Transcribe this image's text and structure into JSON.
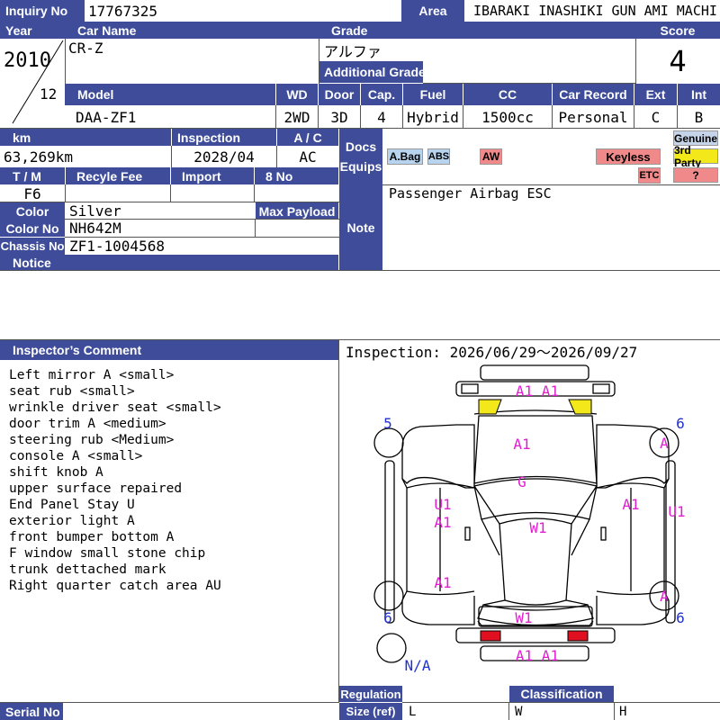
{
  "header": {
    "inquiry_label": "Inquiry No",
    "inquiry_value": "17767325",
    "area_label": "Area",
    "area_value": "IBARAKI INASHIKI GUN AMI MACHI",
    "year_label": "Year",
    "year_value": "2010",
    "month_value": "12",
    "car_name_label": "Car Name",
    "car_name_value": "CR-Z",
    "grade_label": "Grade",
    "grade_value": "アルファ",
    "additional_grade_label": "Additional Grade",
    "score_label": "Score",
    "score_value": "4"
  },
  "spec": {
    "model_label": "Model",
    "model_value": "DAA-ZF1",
    "wd_label": "WD",
    "wd_value": "2WD",
    "door_label": "Door",
    "door_value": "3D",
    "cap_label": "Cap.",
    "cap_value": "4",
    "fuel_label": "Fuel",
    "fuel_value": "Hybrid",
    "cc_label": "CC",
    "cc_value": "1500cc",
    "record_label": "Car Record",
    "record_value": "Personal",
    "ext_label": "Ext",
    "ext_value": "C",
    "int_label": "Int",
    "int_value": "B"
  },
  "details": {
    "km_label": "km",
    "km_value": "63,269km",
    "inspection_label": "Inspection",
    "inspection_value": "2028/04",
    "ac_label": "A / C",
    "ac_value": "AC",
    "tm_label": "T / M",
    "tm_value": "F6",
    "recycle_label": "Recyle Fee",
    "import_label": "Import",
    "no8_label": "8 No",
    "color_label": "Color",
    "color_value": "Silver",
    "payload_label": "Max Payload",
    "color_no_label": "Color No",
    "color_no_value": "NH642M",
    "chassis_label": "Chassis No",
    "chassis_value": "ZF1-1004568",
    "notice_label": "Notice"
  },
  "docs": {
    "docs_label": "Docs",
    "equips_label": "Equips",
    "badges": {
      "abag": "A.Bag",
      "abs": "ABS",
      "aw": "AW",
      "keyless": "Keyless",
      "genuine": "Genuine",
      "third_party": "3rd Party",
      "etc": "ETC",
      "unknown": "?"
    },
    "colors": {
      "blue": "#b7d3ee",
      "red": "#f08a8a",
      "yellow": "#f2e81a",
      "gray_blue": "#c5d4e8"
    }
  },
  "note": {
    "label": "Note",
    "value": "Passenger Airbag ESC"
  },
  "inspector": {
    "label": "Inspector’s Comment",
    "period": "Inspection: 2026/06/29～2026/09/27",
    "comments": [
      "Left mirror A <small>",
      "seat rub <small>",
      "wrinkle driver seat <small>",
      "door trim A <medium>",
      "steering rub <Medium>",
      "console A <small>",
      "shift knob A",
      "upper surface repaired",
      "End Panel Stay U",
      "exterior light A",
      "front bumper bottom A",
      "F window small stone chip",
      "trunk dettached mark",
      "Right quarter catch area AU"
    ]
  },
  "diagram": {
    "front_bumper": "A1  A1",
    "hood": "A1",
    "windshield": "G",
    "left_door": "U1",
    "left_front_fender": "A1",
    "roof": "W1",
    "right_door": "A1",
    "right_quarter": "U1",
    "left_rear": "A1",
    "rear_window": "W1",
    "rear_bumper": "A1  A1",
    "tire_fl": "5",
    "tire_fr": "6",
    "tire_rl": "6",
    "tire_rr": "6",
    "mirror_r_front": "A",
    "mirror_r_rear": "A",
    "spare": "N/A",
    "mark_color": "#e020d0",
    "tire_color": "#2233cc"
  },
  "footer": {
    "serial_label": "Serial No",
    "regulation_label": "Regulation",
    "size_label": "Size (ref)",
    "classification_label": "Classification",
    "l": "L",
    "w": "W",
    "h": "H"
  }
}
